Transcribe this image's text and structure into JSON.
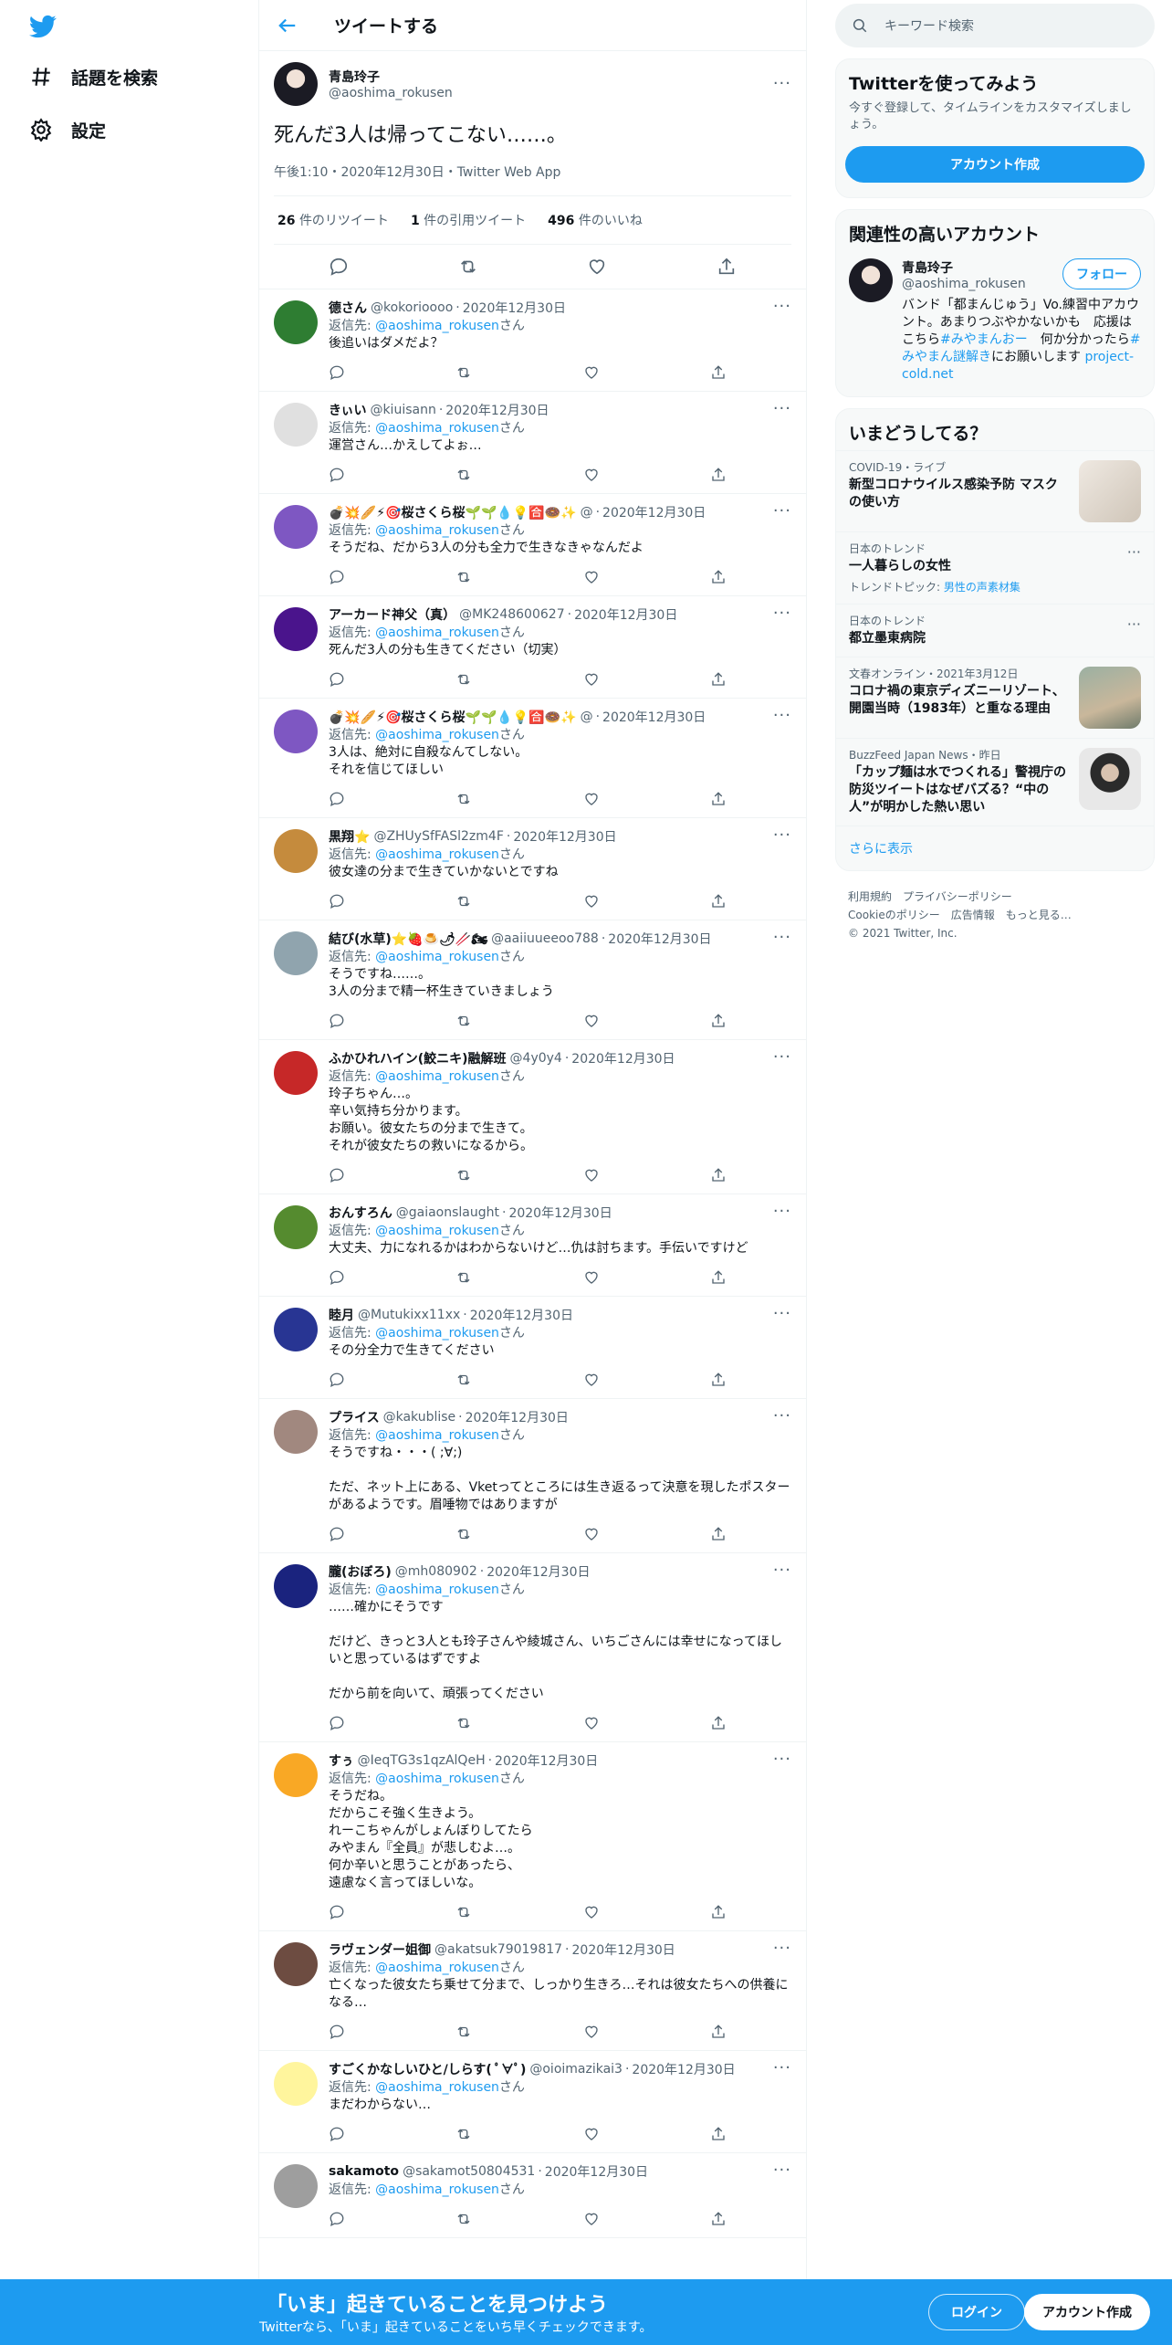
{
  "nav": {
    "explore": "話題を検索",
    "settings": "設定"
  },
  "header": {
    "title": "ツイートする"
  },
  "main_tweet": {
    "name": "青島玲子",
    "handle": "@aoshima_rokusen",
    "text": "死んだ3人は帰ってこない……。",
    "meta": "午後1:10・2020年12月30日・Twitter Web App",
    "retweets_count": "26",
    "retweets_label": "件のリツイート",
    "quotes_count": "1",
    "quotes_label": "件の引用ツイート",
    "likes_count": "496",
    "likes_label": "件のいいね"
  },
  "reply_label": "返信先:",
  "reply_target": "@aoshima_rokusen",
  "reply_san": "さん",
  "replies": [
    {
      "name": "德さん",
      "handle": "@kokorioooo",
      "date": "2020年12月30日",
      "text": "後追いはダメだよ？",
      "color": "#2e7d32"
    },
    {
      "name": "きぃい",
      "handle": "@kiuisann",
      "date": "2020年12月30日",
      "text": "運営さん…かえしてよぉ…",
      "color": "#e0e0e0"
    },
    {
      "name": "💣💥🥖⚡🎯桜さくら桜🌱🌱💧💡🈴🍩✨",
      "handle": "@",
      "date": "2020年12月30日",
      "text": "そうだね、だから3人の分も全力で生きなきゃなんだよ",
      "color": "#7e57c2"
    },
    {
      "name": "アーカード神父（真）",
      "handle": "@MK248600627",
      "date": "2020年12月30日",
      "text": "死んだ3人の分も生きてください（切実）",
      "color": "#4a148c"
    },
    {
      "name": "💣💥🥖⚡🎯桜さくら桜🌱🌱💧💡🈴🍩✨",
      "handle": "@",
      "date": "2020年12月30日",
      "text": "3人は、絶対に自殺なんてしない。\nそれを信じてほしい",
      "color": "#7e57c2"
    },
    {
      "name": "黒翔⭐",
      "handle": "@ZHUySfFASl2zm4F",
      "date": "2020年12月30日",
      "text": "彼女達の分まで生きていかないとですね",
      "color": "#c58b3d"
    },
    {
      "name": "結び(水草)⭐🍓🍮🌶🥢🏍",
      "handle": "@aaiiuueeoo788",
      "date": "2020年12月30日",
      "text": "そうですね……。\n3人の分まで精一杯生きていきましょう",
      "color": "#90a4ae"
    },
    {
      "name": "ふかひれハイン(鮫ニキ)融解班",
      "handle": "@4y0y4",
      "date": "2020年12月30日",
      "text": "玲子ちゃん…。\n辛い気持ち分かります。\nお願い。彼女たちの分まで生きて。\nそれが彼女たちの救いになるから。",
      "color": "#c62828"
    },
    {
      "name": "おんすろん",
      "handle": "@gaiaonslaught",
      "date": "2020年12月30日",
      "text": "大丈夫、力になれるかはわからないけど…仇は討ちます。手伝いですけど",
      "color": "#558b2f"
    },
    {
      "name": "睦月",
      "handle": "@Mutukixx11xx",
      "date": "2020年12月30日",
      "text": "その分全力で生きてください",
      "color": "#283593"
    },
    {
      "name": "プライス",
      "handle": "@kakublise",
      "date": "2020年12月30日",
      "text": "そうですね・・・( ;∀;)\n\nただ、ネット上にある、Vketってところには生き返るって決意を現したポスターがあるようです。眉唾物ではありますが",
      "color": "#a1887f"
    },
    {
      "name": "朧(おぼろ)",
      "handle": "@mh080902",
      "date": "2020年12月30日",
      "text": "……確かにそうです\n\nだけど、きっと3人とも玲子さんや綾城さん、いちごさんには幸せになってほしいと思っているはずですよ\n\nだから前を向いて、頑張ってください",
      "color": "#1a237e"
    },
    {
      "name": "すぅ",
      "handle": "@IeqTG3s1qzAlQeH",
      "date": "2020年12月30日",
      "text": "そうだね。\nだからこそ強く生きよう。\nれーこちゃんがしょんぼりしてたら\nみやまん『全員』が悲しむよ…。\n何か辛いと思うことがあったら、\n遠慮なく言ってほしいな。",
      "color": "#f9a825"
    },
    {
      "name": "ラヴェンダー姐御",
      "handle": "@akatsuk79019817",
      "date": "2020年12月30日",
      "text": "亡くなった彼女たち乗せて分まで、しっかり生きろ…それは彼女たちへの供養になる…",
      "color": "#6d4c41"
    },
    {
      "name": "すごくかなしいひと/しらす( ﾟ∀ﾟ)",
      "handle": "@oioimazikai3",
      "date": "2020年12月30日",
      "text": "まだわからない…",
      "color": "#fff59d"
    },
    {
      "name": "sakamoto",
      "handle": "@sakamot50804531",
      "date": "2020年12月30日",
      "text": "",
      "color": "#9e9e9e"
    }
  ],
  "search": {
    "placeholder": "キーワード検索"
  },
  "signup": {
    "title": "Twitterを使ってみよう",
    "desc": "今すぐ登録して、タイムラインをカスタマイズしましょう。",
    "button": "アカウント作成"
  },
  "related": {
    "title": "関連性の高いアカウント",
    "name": "青島玲子",
    "handle": "@aoshima_rokusen",
    "follow": "フォロー",
    "bio_1": "バンド「都まんじゅう」Vo.練習中アカウント。あまりつぶやかないかも　応援はこちら",
    "bio_tag1": "#みやまんおー",
    "bio_2": "　何か分かったら",
    "bio_tag2": "#みやまん謎解き",
    "bio_3": "にお願いします",
    "bio_link": "project-cold.net"
  },
  "trends": {
    "title": "いまどうしてる？",
    "items": [
      {
        "meta": "COVID-19・ライブ",
        "title": "新型コロナウイルス感染予防 マスクの使い方",
        "sub": "",
        "sub_link": ""
      },
      {
        "meta": "日本のトレンド",
        "title": "一人暮らしの女性",
        "sub": "トレンドトピック: ",
        "sub_link": "男性の声素材集"
      },
      {
        "meta": "日本のトレンド",
        "title": "都立墨東病院",
        "sub": "",
        "sub_link": ""
      },
      {
        "meta": "文春オンライン・2021年3月12日",
        "title": "コロナ禍の東京ディズニーリゾート、開園当時（1983年）と重なる理由",
        "sub": "",
        "sub_link": ""
      },
      {
        "meta": "BuzzFeed Japan News・昨日",
        "title": "「カップ麺は水でつくれる」警視庁の防災ツイートはなぜバズる？“中の人”が明かした熱い思い",
        "sub": "",
        "sub_link": ""
      }
    ],
    "show_more": "さらに表示"
  },
  "footer": {
    "terms": "利用規約",
    "privacy": "プライバシーポリシー",
    "cookie": "Cookieのポリシー",
    "ads": "広告情報",
    "more": "もっと見る…",
    "copyright": "© 2021 Twitter, Inc."
  },
  "bottom": {
    "title": "「いま」起きていることを見つけよう",
    "sub": "Twitterなら、「いま」起きていることをいち早くチェックできます。",
    "login": "ログイン",
    "signup": "アカウント作成"
  },
  "colors": {
    "accent": "#1d9bf0",
    "text": "#0f1419",
    "muted": "#536471"
  }
}
